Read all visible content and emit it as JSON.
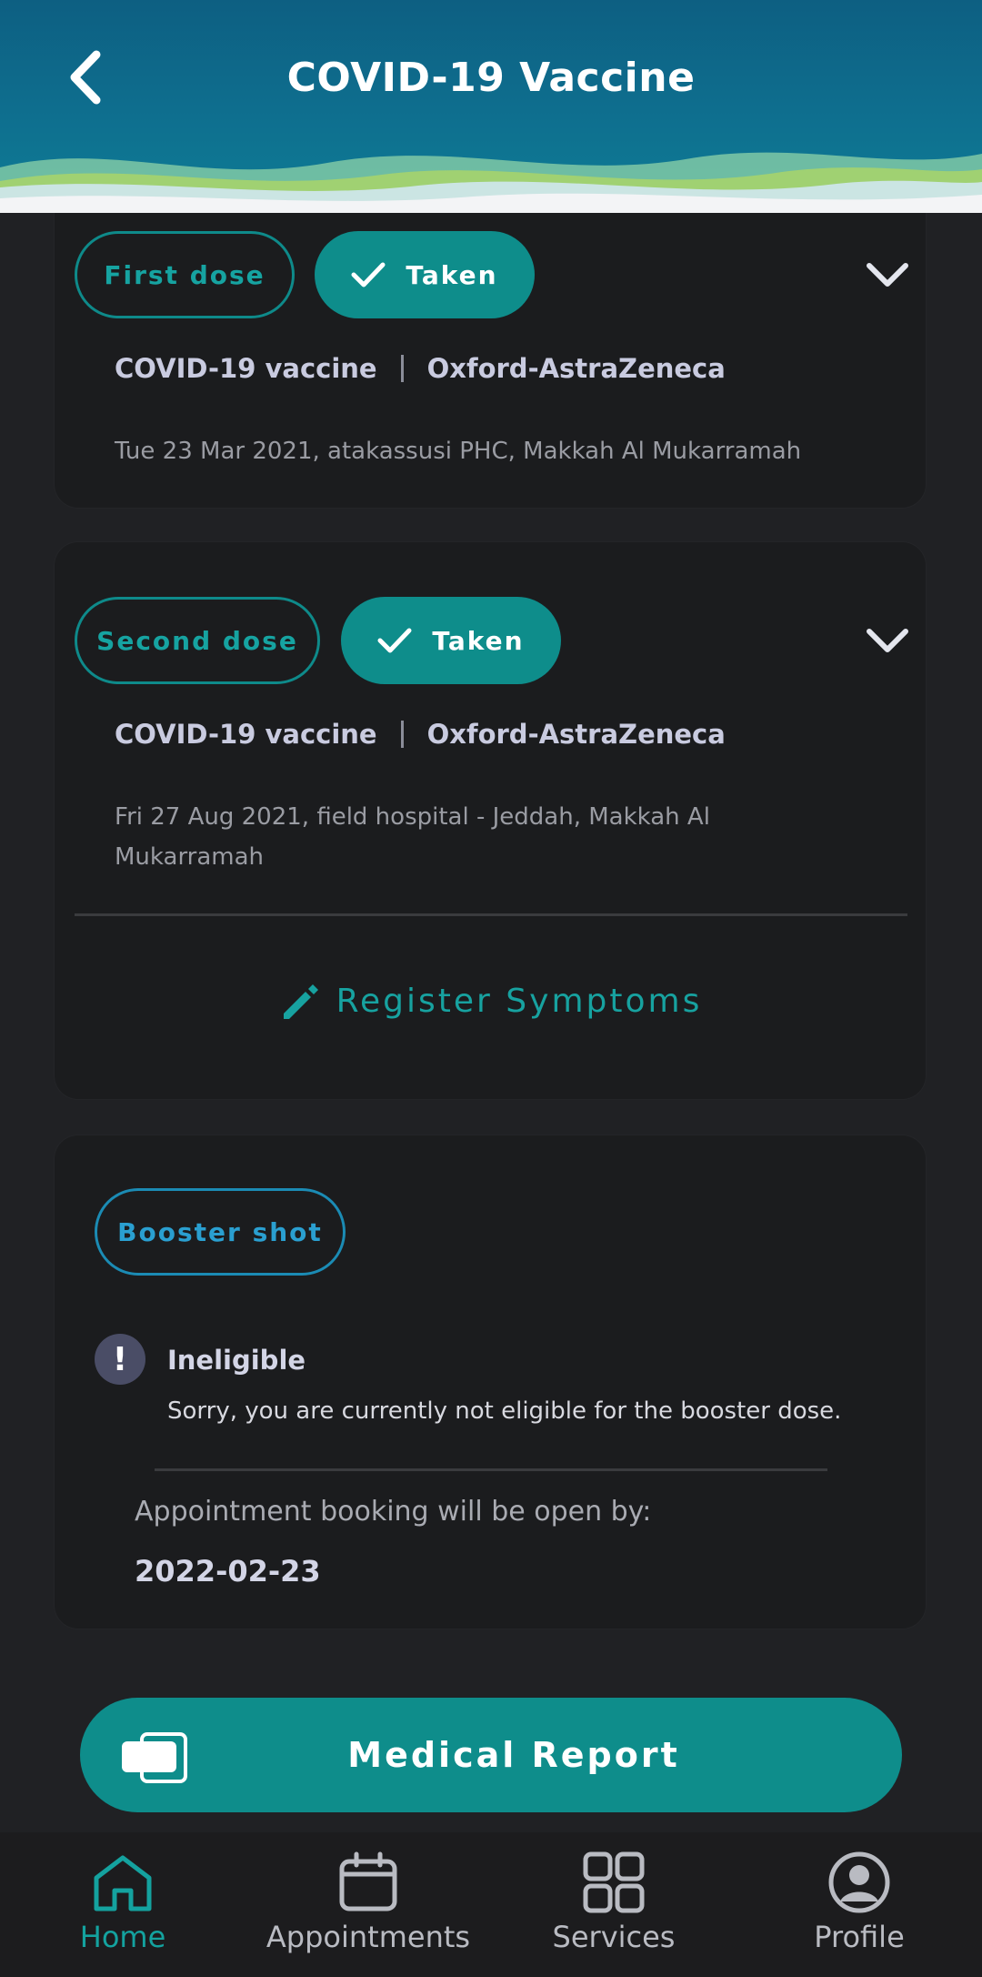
{
  "header": {
    "title": "COVID-19 Vaccine"
  },
  "doses": [
    {
      "dose_label": "First dose",
      "status": "Taken",
      "vaccine": "COVID-19 vaccine",
      "manufacturer": "Oxford-AstraZeneca",
      "details": "Tue 23 Mar 2021, atakassusi PHC, Makkah Al Mukarramah"
    },
    {
      "dose_label": "Second dose",
      "status": "Taken",
      "vaccine": "COVID-19 vaccine",
      "manufacturer": "Oxford-AstraZeneca",
      "details": "Fri 27 Aug 2021, field hospital - Jeddah, Makkah Al Mukarramah",
      "register_label": "Register Symptoms"
    }
  ],
  "booster": {
    "label": "Booster shot",
    "status_title": "Ineligible",
    "status_text": "Sorry, you are currently not eligible for the booster dose.",
    "open_label": "Appointment booking will be open by:",
    "open_date": "2022-02-23"
  },
  "report_button": "Medical Report",
  "nav": [
    {
      "label": "Home",
      "icon": "home-icon",
      "active": true
    },
    {
      "label": "Appointments",
      "icon": "calendar-icon",
      "active": false
    },
    {
      "label": "Services",
      "icon": "grid-icon",
      "active": false
    },
    {
      "label": "Profile",
      "icon": "user-icon",
      "active": false
    }
  ],
  "colors": {
    "accent": "#0e8d8b",
    "background": "#202124",
    "card": "#1b1c1e",
    "booster": "#1b8bb4"
  }
}
